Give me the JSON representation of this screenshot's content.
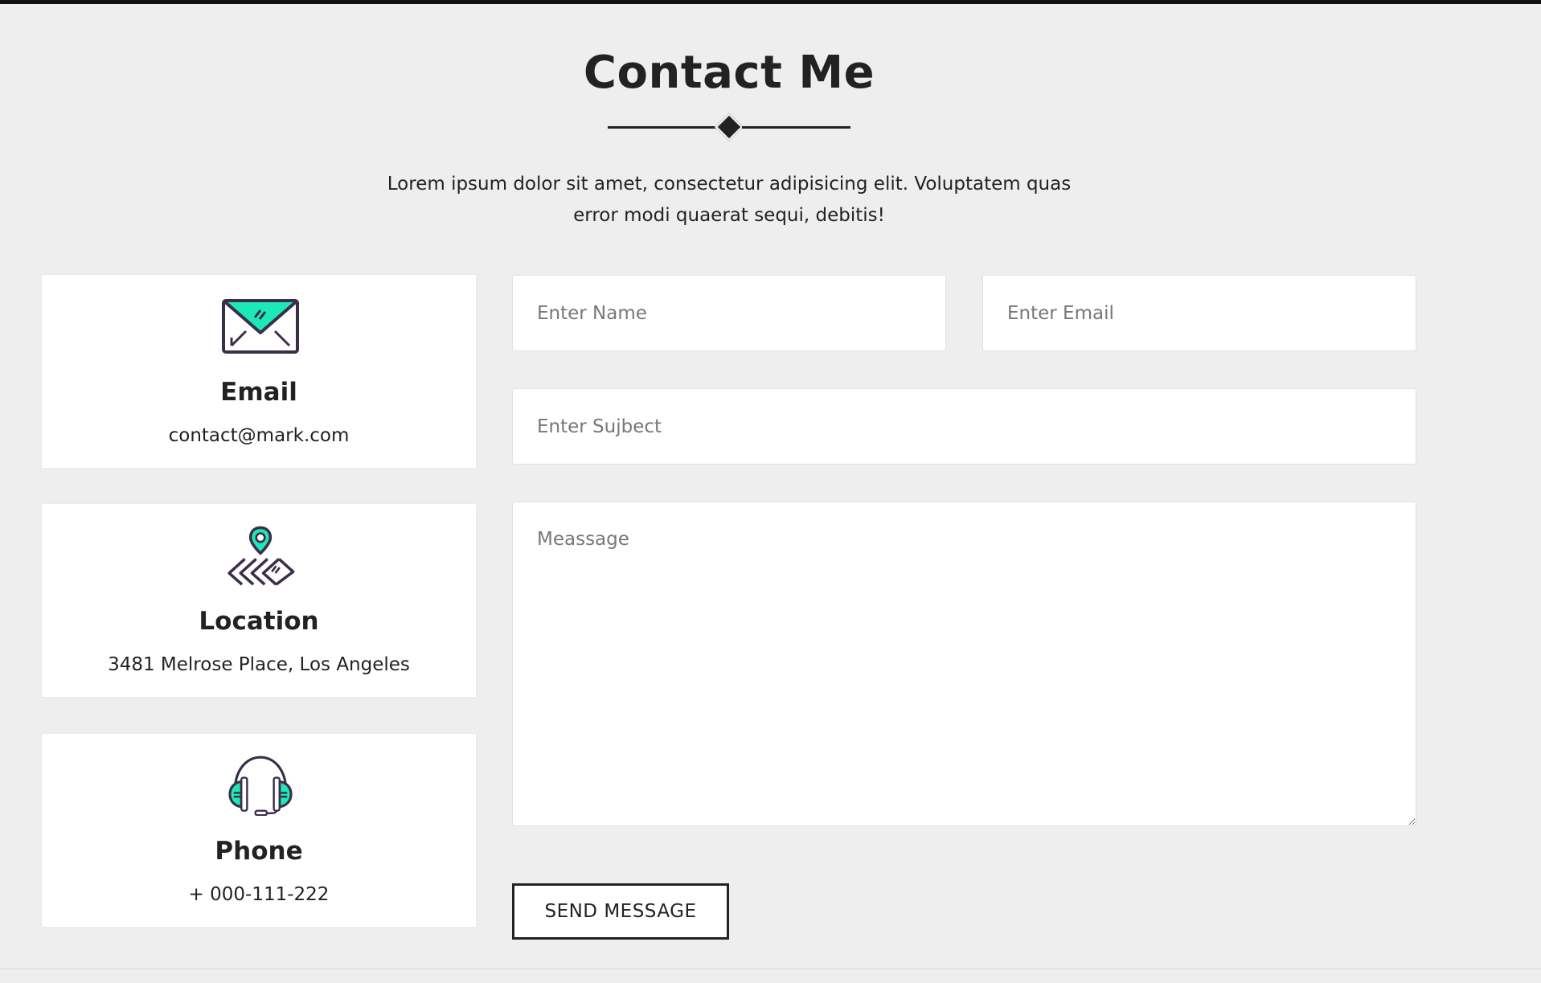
{
  "header": {
    "title": "Contact Me",
    "intro_line1": "Lorem ipsum dolor sit amet, consectetur adipisicing elit. Voluptatem quas",
    "intro_line2": "error modi quaerat sequi, debitis!"
  },
  "cards": {
    "email": {
      "icon": "envelope-icon",
      "title": "Email",
      "value": "contact@mark.com"
    },
    "location": {
      "icon": "map-pin-icon",
      "title": "Location",
      "value": "3481 Melrose Place, Los Angeles"
    },
    "phone": {
      "icon": "headset-icon",
      "title": "Phone",
      "value": "+ 000-111-222"
    }
  },
  "form": {
    "name": {
      "placeholder": "Enter Name",
      "value": ""
    },
    "email": {
      "placeholder": "Enter Email",
      "value": ""
    },
    "subject": {
      "placeholder": "Enter Sujbect",
      "value": ""
    },
    "message": {
      "placeholder": "Meassage",
      "value": ""
    },
    "submit_label": "SEND MESSAGE"
  },
  "colors": {
    "background": "#eeeeee",
    "text": "#222222",
    "accent": "#1de9b6",
    "icon_stroke": "#3b2e4a",
    "card": "#ffffff"
  }
}
